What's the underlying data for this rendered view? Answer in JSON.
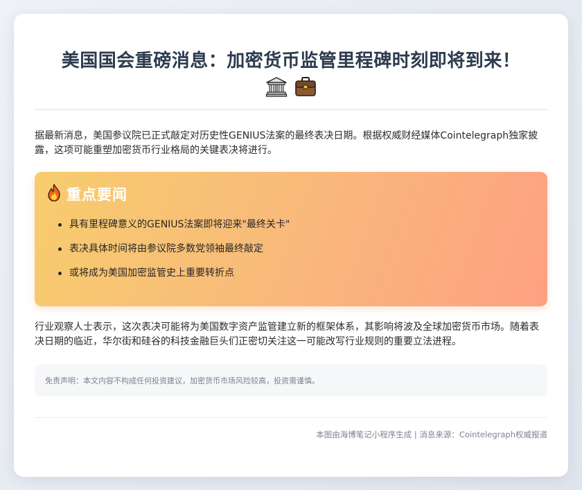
{
  "article": {
    "title": "美国国会重磅消息：加密货币监管里程碑时刻即将到来！",
    "title_icons": [
      "classical-building-icon",
      "briefcase-icon"
    ],
    "intro": "据最新消息，美国参议院已正式敲定对历史性GENIUS法案的最终表决日期。根据权威财经媒体Cointelegraph独家披露，这项可能重塑加密货币行业格局的关键表决将进行。",
    "highlight": {
      "icon": "fire-icon",
      "title": "重点要闻",
      "items": [
        "具有里程碑意义的GENIUS法案即将迎来\"最终关卡\"",
        "表决具体时间将由参议院多数党领袖最终敲定",
        "或将成为美国加密监管史上重要转折点"
      ]
    },
    "observation": "行业观察人士表示，这次表决可能将为美国数字资产监管建立新的框架体系，其影响将波及全球加密货币市场。随着表决日期的临近，华尔街和硅谷的科技金融巨头们正密切关注这一可能改写行业规则的重要立法进程。",
    "disclaimer": "免责声明：本文内容不构成任何投资建议，加密货币市场风险较高，投资需谨慎。",
    "footer": "本图由海博笔记小程序生成 | 消息来源：Cointelegraph权威报道"
  },
  "colors": {
    "background": "#e6eaf1",
    "card": "#ffffff",
    "title": "#2d3b4e",
    "highlight_gradient": [
      "#f7cd6e",
      "#fea081"
    ],
    "muted_text": "#7c8290"
  }
}
